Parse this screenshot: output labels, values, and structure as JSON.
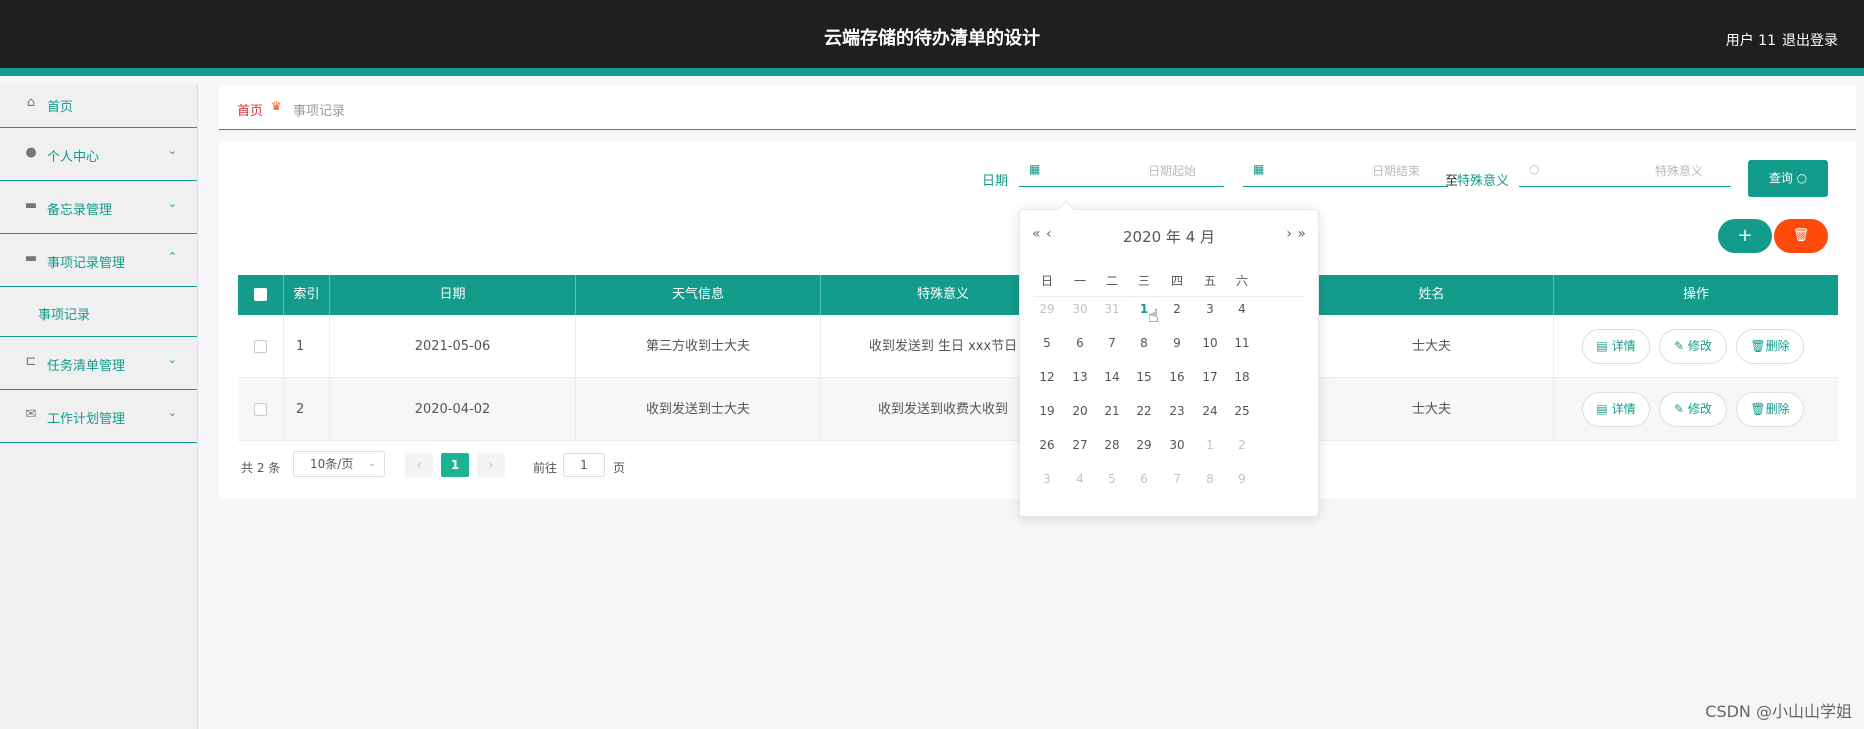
{
  "header": {
    "title": "云端存储的待办清单的设计",
    "user": "用户 11",
    "logout": "退出登录"
  },
  "sidebar": {
    "items": [
      {
        "label": "首页",
        "icon": "home-icon",
        "chevron": ""
      },
      {
        "label": "个人中心",
        "icon": "user-icon",
        "chevron": "⌄"
      },
      {
        "label": "备忘录管理",
        "icon": "monitor-icon",
        "chevron": "⌄"
      },
      {
        "label": "事项记录管理",
        "icon": "monitor-icon",
        "chevron": "⌃",
        "sub": "事项记录"
      },
      {
        "label": "任务清单管理",
        "icon": "crop-icon",
        "chevron": "⌄"
      },
      {
        "label": "工作计划管理",
        "icon": "mail-icon",
        "chevron": "⌄"
      }
    ]
  },
  "breadcrumb": {
    "home": "首页",
    "current": "事项记录"
  },
  "filters": {
    "date_label": "日期",
    "start_placeholder": "日期起始",
    "to": "至",
    "end_placeholder": "日期结束",
    "special_label": "特殊意义",
    "special_placeholder": "特殊意义",
    "query_label": "查询"
  },
  "actions": {
    "add": "+",
    "delete": "🗑"
  },
  "table": {
    "headers": [
      "索引",
      "日期",
      "天气信息",
      "特殊意义",
      "姓名",
      "操作"
    ],
    "rows": [
      {
        "index": "1",
        "date": "2021-05-06",
        "weather": "第三方收到士大夫",
        "special": "收到发送到 生日 xxx节日",
        "name": "士大夫"
      },
      {
        "index": "2",
        "date": "2020-04-02",
        "weather": "收到发送到士大夫",
        "special": "收到发送到收费大收到",
        "name": "士大夫"
      }
    ],
    "ops": {
      "detail": "详情",
      "edit": "修改",
      "delete": "删除"
    }
  },
  "pagination": {
    "total": "共 2 条",
    "page_size": "10条/页",
    "current": "1",
    "goto": "前往",
    "goto_value": "1",
    "page_suffix": "页"
  },
  "datepicker": {
    "title": "2020 年 4 月",
    "weekdays": [
      "日",
      "一",
      "二",
      "三",
      "四",
      "五",
      "六"
    ],
    "weeks": [
      [
        "29",
        "30",
        "31",
        "1",
        "2",
        "3",
        "4"
      ],
      [
        "5",
        "6",
        "7",
        "8",
        "9",
        "10",
        "11"
      ],
      [
        "12",
        "13",
        "14",
        "15",
        "16",
        "17",
        "18"
      ],
      [
        "19",
        "20",
        "21",
        "22",
        "23",
        "24",
        "25"
      ],
      [
        "26",
        "27",
        "28",
        "29",
        "30",
        "1",
        "2"
      ],
      [
        "3",
        "4",
        "5",
        "6",
        "7",
        "8",
        "9"
      ]
    ],
    "dim": [
      [
        0,
        0
      ],
      [
        0,
        1
      ],
      [
        0,
        2
      ],
      [
        4,
        5
      ],
      [
        4,
        6
      ],
      [
        5,
        0
      ],
      [
        5,
        1
      ],
      [
        5,
        2
      ],
      [
        5,
        3
      ],
      [
        5,
        4
      ],
      [
        5,
        5
      ],
      [
        5,
        6
      ]
    ],
    "today": [
      0,
      3
    ]
  },
  "watermark": "CSDN @小山山学姐",
  "colors": {
    "accent": "#139b8c",
    "danger": "#ff4a0c",
    "header_bg": "#1f1f1f"
  }
}
